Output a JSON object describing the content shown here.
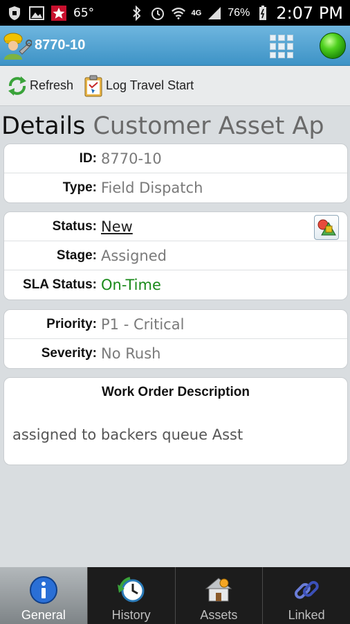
{
  "status_bar": {
    "temperature": "65°",
    "network": "4G",
    "battery": "76%",
    "time": "2:07 PM"
  },
  "app_bar": {
    "title": "8770-10"
  },
  "toolbar": {
    "refresh_label": "Refresh",
    "log_travel_label": "Log Travel Start"
  },
  "heading": {
    "main": "Details",
    "sub": "Customer Asset Ap"
  },
  "card_ids": [
    {
      "label": "ID:",
      "value": "8770-10"
    },
    {
      "label": "Type:",
      "value": "Field Dispatch"
    }
  ],
  "card_status": [
    {
      "label": "Status:",
      "value": "New"
    },
    {
      "label": "Stage:",
      "value": "Assigned"
    },
    {
      "label": "SLA Status:",
      "value": "On-Time"
    }
  ],
  "card_priority": [
    {
      "label": "Priority:",
      "value": "P1 - Critical"
    },
    {
      "label": "Severity:",
      "value": "No Rush"
    }
  ],
  "description": {
    "title": "Work Order Description",
    "text": "assigned to backers queue Asst"
  },
  "bottom_nav": [
    {
      "label": "General",
      "icon": "info-icon",
      "active": true
    },
    {
      "label": "History",
      "icon": "history-icon",
      "active": false
    },
    {
      "label": "Assets",
      "icon": "assets-icon",
      "active": false
    },
    {
      "label": "Linked",
      "icon": "link-icon",
      "active": false
    }
  ],
  "colors": {
    "app_bar": "#3d93c6",
    "sla_green": "#1a8a1a",
    "status_orb": "#4fd11f"
  }
}
